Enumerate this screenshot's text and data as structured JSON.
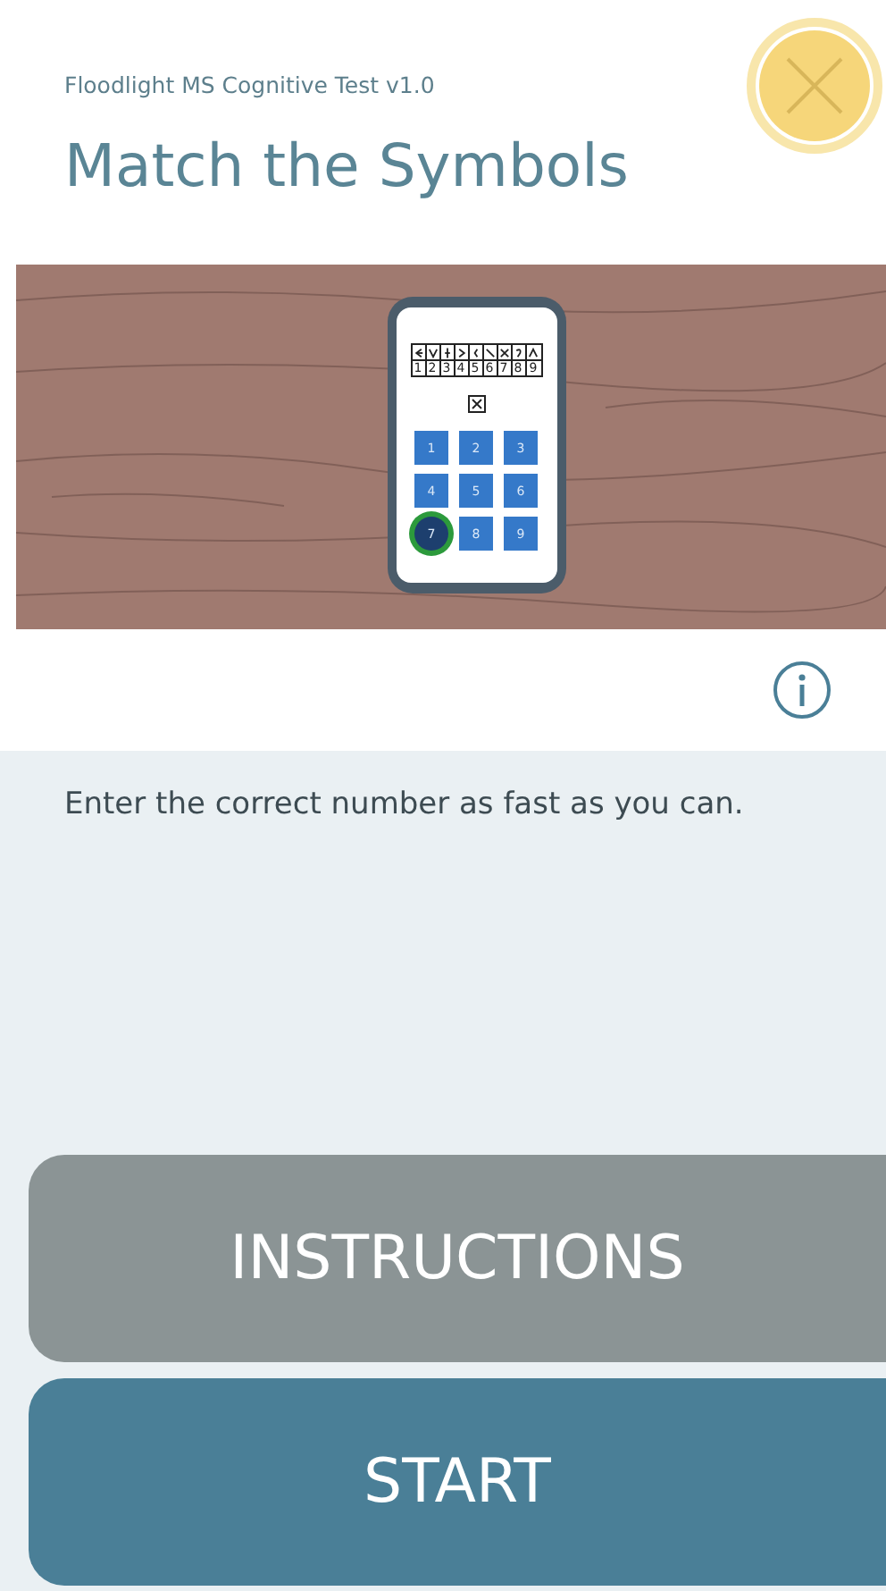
{
  "app_name": "Floodlight MS Cognitive Test v1.0",
  "title": "Match the Symbols",
  "illustration": {
    "key_digits": [
      "1",
      "2",
      "3",
      "4",
      "5",
      "6",
      "7",
      "8",
      "9"
    ],
    "keypad": [
      {
        "label": "1",
        "selected": false
      },
      {
        "label": "2",
        "selected": false
      },
      {
        "label": "3",
        "selected": false
      },
      {
        "label": "4",
        "selected": false
      },
      {
        "label": "5",
        "selected": false
      },
      {
        "label": "6",
        "selected": false
      },
      {
        "label": "7",
        "selected": true
      },
      {
        "label": "8",
        "selected": false
      },
      {
        "label": "9",
        "selected": false
      }
    ]
  },
  "instruction_text": "Enter the correct number as fast as you can.",
  "buttons": [
    {
      "label": "INSTRUCTIONS",
      "kind": "secondary"
    },
    {
      "label": "START",
      "kind": "primary"
    }
  ]
}
